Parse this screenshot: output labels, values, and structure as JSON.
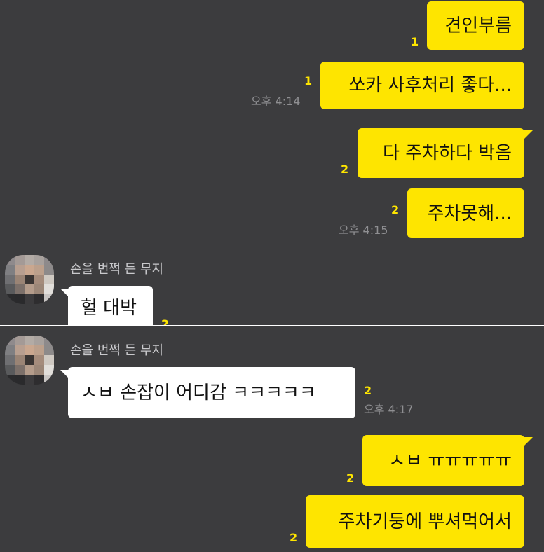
{
  "messages_top": {
    "m1": {
      "text": "견인부름",
      "unread": "1"
    },
    "m2": {
      "text": "쏘카 사후처리 좋다...",
      "unread": "1",
      "time": "오후 4:14"
    },
    "m3": {
      "text": "다 주차하다 박음",
      "unread": "2"
    },
    "m4": {
      "text": "주차못해...",
      "unread": "2",
      "time": "오후 4:15"
    },
    "sender": "손을 번쩍 든 무지",
    "m5": {
      "text": "헐 대박",
      "unread": "2"
    }
  },
  "messages_bottom": {
    "sender": "손을 번쩍 든 무지",
    "m6": {
      "text": "ㅅㅂ 손잡이 어디감 ㅋㅋㅋㅋㅋ",
      "unread": "2",
      "time": "오후 4:17"
    },
    "m7": {
      "text": "ㅅㅂ ㅠㅠㅠㅠㅠ",
      "unread": "2"
    },
    "m8": {
      "text": "주차기둥에 뿌셔먹어서",
      "unread": "2"
    }
  },
  "colors": {
    "background": "#3c3c3e",
    "my_bubble": "#fee500",
    "their_bubble": "#ffffff",
    "unread_count": "#fee500",
    "timestamp": "#8f8f92"
  },
  "icons": {
    "avatar": "pixelated-profile-avatar"
  }
}
